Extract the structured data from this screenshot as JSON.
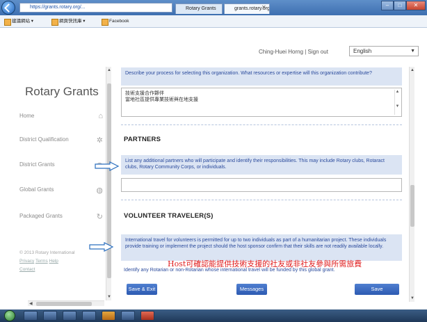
{
  "browser": {
    "address": "https://grants.rotary.org/...",
    "tabs": [
      "Rotary Grants",
      "grants.rotary.org"
    ],
    "favorites": [
      "建議網站 ▾",
      "網頁快訊庫 ▾",
      "Facebook"
    ]
  },
  "header": {
    "user": "Ching-Huei Horng | Sign out",
    "language": "English"
  },
  "sidebar": {
    "title": "Rotary Grants",
    "items": [
      {
        "label": "Home",
        "icon": "home-icon"
      },
      {
        "label": "District Qualification",
        "icon": "star-icon"
      },
      {
        "label": "District Grants",
        "icon": "globe-icon"
      },
      {
        "label": "Global Grants",
        "icon": "globe-icon"
      },
      {
        "label": "Packaged Grants",
        "icon": "cycle-icon"
      }
    ],
    "footer": {
      "copyright": "© 2013 Rotary International",
      "links": [
        "Privacy",
        "Terms",
        "Help",
        "Contact"
      ]
    }
  },
  "main": {
    "question_1": "Describe your process for selecting this organization. What resources or expertise will this organization contribute?",
    "answer_1_line1": "技術支援合作夥伴",
    "answer_1_line2": "當地社區提供專業技術與在地支援",
    "partners_title": "PARTNERS",
    "partners_hint": "List any additional partners who will participate and identify their responsibilities. This may include Rotary clubs, Rotaract clubs, Rotary Community Corps, or individuals.",
    "partners_value": "",
    "volunteer_title": "VOLUNTEER TRAVELER(S)",
    "volunteer_hint": "International travel for volunteers is permitted for up to two individuals as part of a humanitarian project. These individuals provide training or implement the project should the host sponsor confirm that their skills are not readily available locally.",
    "volunteer_identify": "Identify any Rotarian or non-Rotarian whose international travel will be funded by this global grant.",
    "buttons": {
      "save_exit": "Save & Exit",
      "messages": "Messages",
      "save": "Save"
    }
  },
  "annotation": {
    "text": "Host可確認能提供技術支援的社友或非社友參與所需旅費",
    "color": "#e01b1b"
  },
  "colors": {
    "accent": "#2d5ab2",
    "hint_bg": "#dbe4f3",
    "hint_text": "#2a4a9c"
  }
}
